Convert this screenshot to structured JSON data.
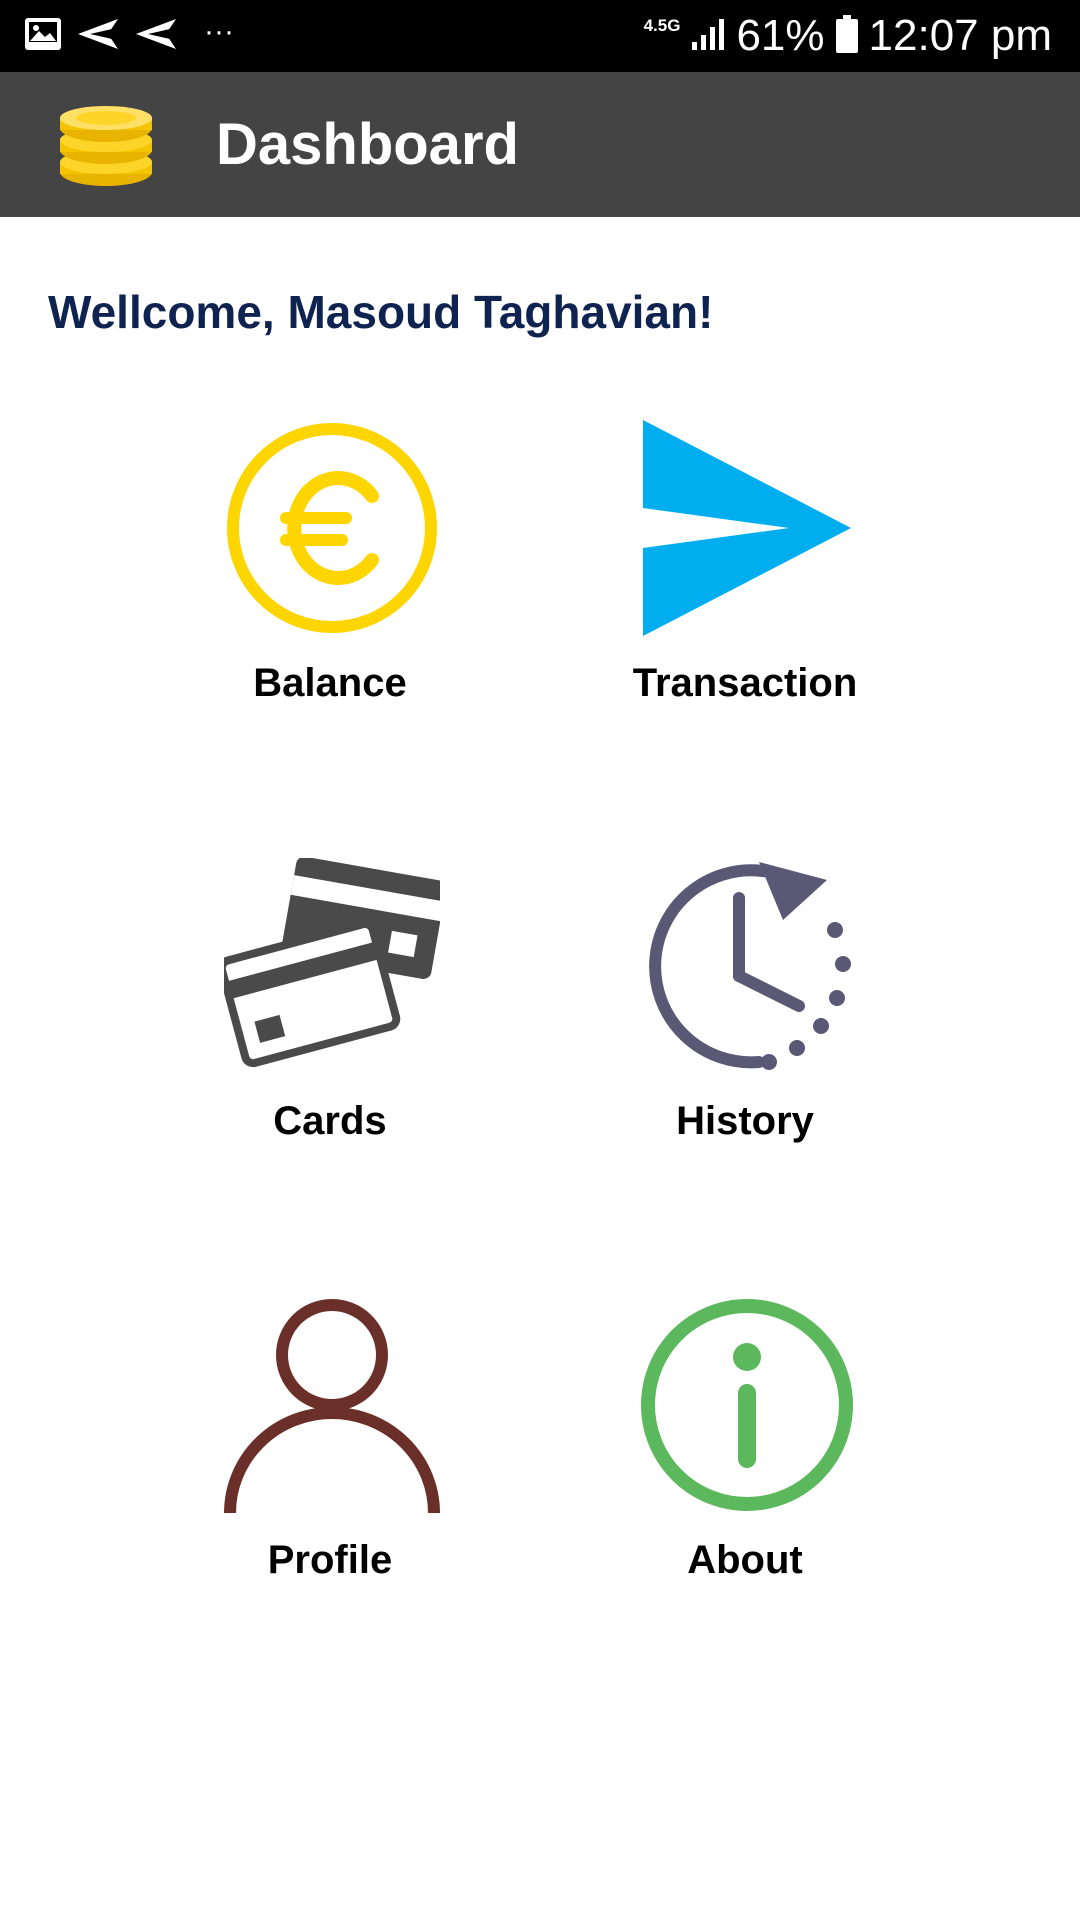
{
  "status_bar": {
    "network": "4.5G",
    "battery": "61%",
    "time": "12:07 pm",
    "more": "···",
    "icons": [
      "image-icon",
      "send-icon",
      "send-icon",
      "more-icon",
      "signal-icon",
      "battery-icon"
    ]
  },
  "app_bar": {
    "title": "Dashboard",
    "logo_icon": "coins-icon"
  },
  "welcome": "Wellcome, Masoud Taghavian!",
  "tiles": [
    {
      "label": "Balance",
      "icon": "euro-coin-icon",
      "color": "#FFD500"
    },
    {
      "label": "Transaction",
      "icon": "send-arrow-icon",
      "color": "#00AEEF"
    },
    {
      "label": "Cards",
      "icon": "credit-cards-icon",
      "color": "#4a4a4a"
    },
    {
      "label": "History",
      "icon": "history-clock-icon",
      "color": "#5b5875"
    },
    {
      "label": "Profile",
      "icon": "user-icon",
      "color": "#6b2f2a"
    },
    {
      "label": "About",
      "icon": "info-icon",
      "color": "#5cb85c"
    }
  ],
  "colors": {
    "status_bar_bg": "#000000",
    "app_bar_bg": "#444444",
    "welcome_text": "#0f2350",
    "page_bg": "#ffffff"
  }
}
